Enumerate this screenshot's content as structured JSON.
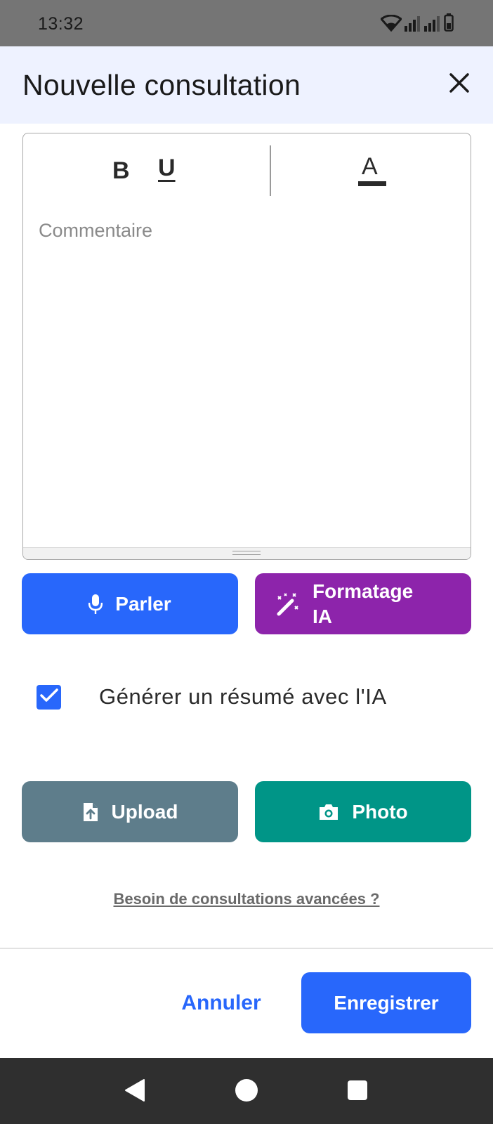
{
  "status_bar": {
    "time": "13:32",
    "icons": [
      "wifi-icon",
      "signal-icon",
      "signal-icon",
      "battery-icon"
    ]
  },
  "header": {
    "title": "Nouvelle consultation",
    "close_icon": "close-icon"
  },
  "editor": {
    "toolbar": {
      "bold_label": "B",
      "underline_label": "U",
      "text_color_label": "A"
    },
    "placeholder": "Commentaire"
  },
  "actions": {
    "speak_label": "Parler",
    "speak_icon": "microphone-icon",
    "ai_format_label_line1": "Formatage",
    "ai_format_label_line2": "IA",
    "ai_format_icon": "magic-wand-icon"
  },
  "summary_option": {
    "label": "Générer un résumé avec l'IA",
    "checked": true
  },
  "attachments": {
    "upload_label": "Upload",
    "upload_icon": "file-upload-icon",
    "photo_label": "Photo",
    "photo_icon": "camera-icon"
  },
  "advanced_link": "Besoin de consultations avancées ?",
  "footer": {
    "cancel_label": "Annuler",
    "save_label": "Enregistrer"
  },
  "colors": {
    "primary": "#2867fb",
    "ai_purple": "#8d24ab",
    "upload_gray": "#5e7d8b",
    "photo_teal": "#009587",
    "header_bg": "#eef2ff"
  }
}
